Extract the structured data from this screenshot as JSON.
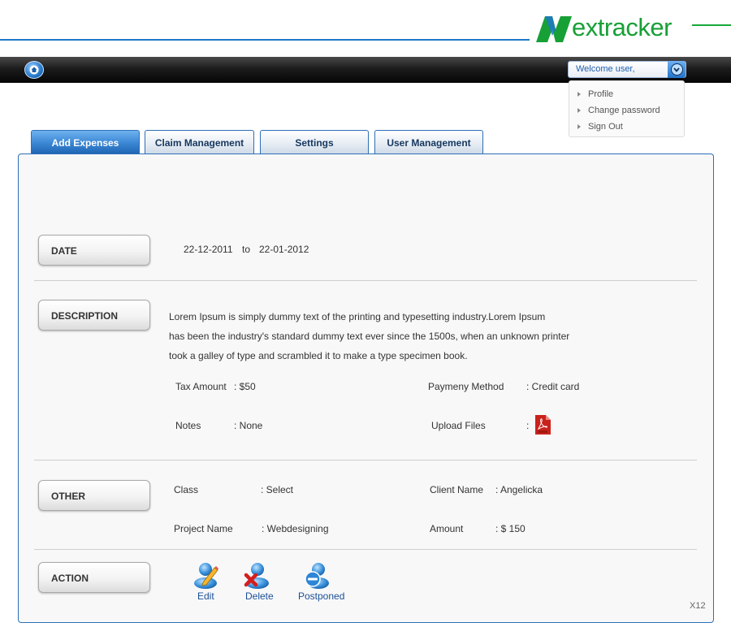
{
  "brand": {
    "logo_text": "extracker",
    "colors": {
      "green": "#17a036",
      "blue": "#1f78c8"
    }
  },
  "navbar": {
    "home_icon": "home-icon",
    "welcome_label": "Welcome user,",
    "user_menu": [
      "Profile",
      "Change password",
      "Sign Out"
    ]
  },
  "tabs": [
    {
      "label": "Add Expenses",
      "active": true
    },
    {
      "label": "Claim Management",
      "active": false
    },
    {
      "label": "Settings",
      "active": false
    },
    {
      "label": "User Management",
      "active": false
    }
  ],
  "date": {
    "section_label": "DATE",
    "from": "22-12-2011",
    "separator": "to",
    "to": "22-01-2012"
  },
  "description": {
    "section_label": "DESCRIPTION",
    "lines": [
      "Lorem Ipsum is simply dummy text of the printing and typesetting industry.Lorem Ipsum",
      "has been the industry's standard dummy text ever since the 1500s, when an unknown printer",
      "took a galley of type and scrambled it to make a type specimen book."
    ],
    "tax_label": "Tax Amount",
    "tax_value": ": $50",
    "payment_label": "Paymeny Method",
    "payment_value": ": Credit card",
    "notes_label": "Notes",
    "notes_value": ": None",
    "upload_label": "Upload Files",
    "upload_sep": ":",
    "upload_icon": "pdf-file-icon"
  },
  "other": {
    "section_label": "OTHER",
    "class_label": "Class",
    "class_value": ":  Select",
    "client_label": "Client Name",
    "client_value": ": Angelicka",
    "project_label": "Project Name",
    "project_value": ": Webdesigning",
    "amount_label": "Amount",
    "amount_value": ": $ 150"
  },
  "action": {
    "section_label": "ACTION",
    "buttons": [
      {
        "label": "Edit",
        "icon": "edit-user-icon"
      },
      {
        "label": "Delete",
        "icon": "delete-user-icon"
      },
      {
        "label": "Postponed",
        "icon": "postpone-user-icon"
      }
    ]
  },
  "footer": {
    "code": "X12"
  }
}
